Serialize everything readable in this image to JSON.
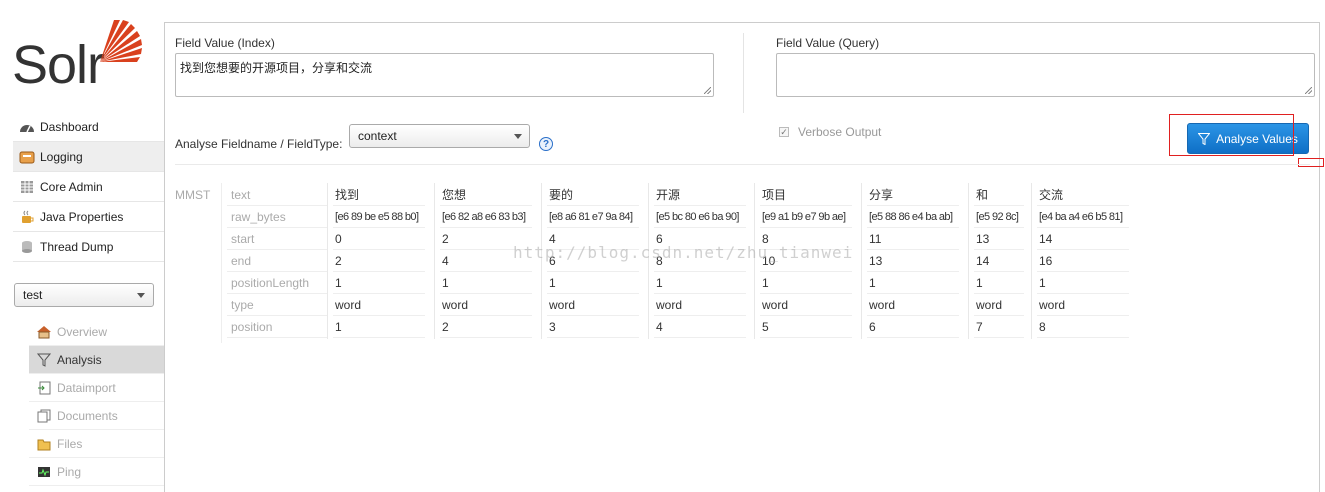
{
  "app": {
    "logo_text": "Solr"
  },
  "nav": [
    {
      "label": "Dashboard",
      "icon": "dashboard-icon",
      "active": false
    },
    {
      "label": "Logging",
      "icon": "logging-icon",
      "active": true
    },
    {
      "label": "Core Admin",
      "icon": "core-admin-icon",
      "active": false
    },
    {
      "label": "Java Properties",
      "icon": "java-icon",
      "active": false
    },
    {
      "label": "Thread Dump",
      "icon": "thread-dump-icon",
      "active": false
    }
  ],
  "core_selector": {
    "value": "test"
  },
  "core_nav": [
    {
      "label": "Overview",
      "icon": "home-icon"
    },
    {
      "label": "Analysis",
      "icon": "funnel-icon",
      "active": true
    },
    {
      "label": "Dataimport",
      "icon": "dataimport-icon"
    },
    {
      "label": "Documents",
      "icon": "documents-icon"
    },
    {
      "label": "Files",
      "icon": "files-icon"
    },
    {
      "label": "Ping",
      "icon": "ping-icon"
    }
  ],
  "analysis": {
    "index_label": "Field Value (Index)",
    "index_value": "找到您想要的开源项目，分享和交流",
    "query_label": "Field Value (Query)",
    "query_value": "",
    "fieldtype_label": "Analyse Fieldname / FieldType:",
    "fieldtype_value": "context",
    "help": "?",
    "verbose_label": "Verbose Output",
    "verbose_checked": true,
    "analyse_button": "Analyse Values",
    "analyzer_name": "MMST",
    "watermark": "http://blog.csdn.net/zhu_tianwei"
  },
  "props": [
    "text",
    "raw_bytes",
    "start",
    "end",
    "positionLength",
    "type",
    "position"
  ],
  "tokens": [
    {
      "text": "找到",
      "raw_bytes": "[e6 89 be e5 88 b0]",
      "start": "0",
      "end": "2",
      "positionLength": "1",
      "type": "word",
      "position": "1"
    },
    {
      "text": "您想",
      "raw_bytes": "[e6 82 a8 e6 83 b3]",
      "start": "2",
      "end": "4",
      "positionLength": "1",
      "type": "word",
      "position": "2"
    },
    {
      "text": "要的",
      "raw_bytes": "[e8 a6 81 e7 9a 84]",
      "start": "4",
      "end": "6",
      "positionLength": "1",
      "type": "word",
      "position": "3"
    },
    {
      "text": "开源",
      "raw_bytes": "[e5 bc 80 e6 ba 90]",
      "start": "6",
      "end": "8",
      "positionLength": "1",
      "type": "word",
      "position": "4"
    },
    {
      "text": "项目",
      "raw_bytes": "[e9 a1 b9 e7 9b ae]",
      "start": "8",
      "end": "10",
      "positionLength": "1",
      "type": "word",
      "position": "5"
    },
    {
      "text": "分享",
      "raw_bytes": "[e5 88 86 e4 ba ab]",
      "start": "11",
      "end": "13",
      "positionLength": "1",
      "type": "word",
      "position": "6"
    },
    {
      "text": "和",
      "raw_bytes": "[e5 92 8c]",
      "start": "13",
      "end": "14",
      "positionLength": "1",
      "type": "word",
      "position": "7"
    },
    {
      "text": "交流",
      "raw_bytes": "[e4 ba a4 e6 b5 81]",
      "start": "14",
      "end": "16",
      "positionLength": "1",
      "type": "word",
      "position": "8"
    }
  ]
}
